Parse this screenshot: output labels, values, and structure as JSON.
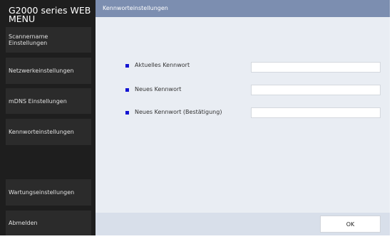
{
  "app": {
    "title": "G2000 series WEB MENU"
  },
  "sidebar": {
    "items": [
      {
        "label": "Scannername Einstellungen"
      },
      {
        "label": "Netzwerkeinstellungen"
      },
      {
        "label": "mDNS Einstellungen"
      },
      {
        "label": "Kennworteinstellungen"
      },
      {
        "label": "Wartungseinstellungen"
      },
      {
        "label": "Abmelden"
      }
    ]
  },
  "page": {
    "title": "Kennworteinstellungen"
  },
  "form": {
    "fields": [
      {
        "label": "Aktuelles Kennwort",
        "value": ""
      },
      {
        "label": "Neues Kennwort",
        "value": ""
      },
      {
        "label": "Neues Kennwort (Bestätigung)",
        "value": ""
      }
    ]
  },
  "footer": {
    "ok_label": "OK"
  },
  "colors": {
    "sidebar_bg": "#1e1e1e",
    "nav_button_bg": "#2b2b2b",
    "header_bg": "#7c8eb0",
    "content_bg": "#e9edf3",
    "bullet": "#1414d2"
  }
}
